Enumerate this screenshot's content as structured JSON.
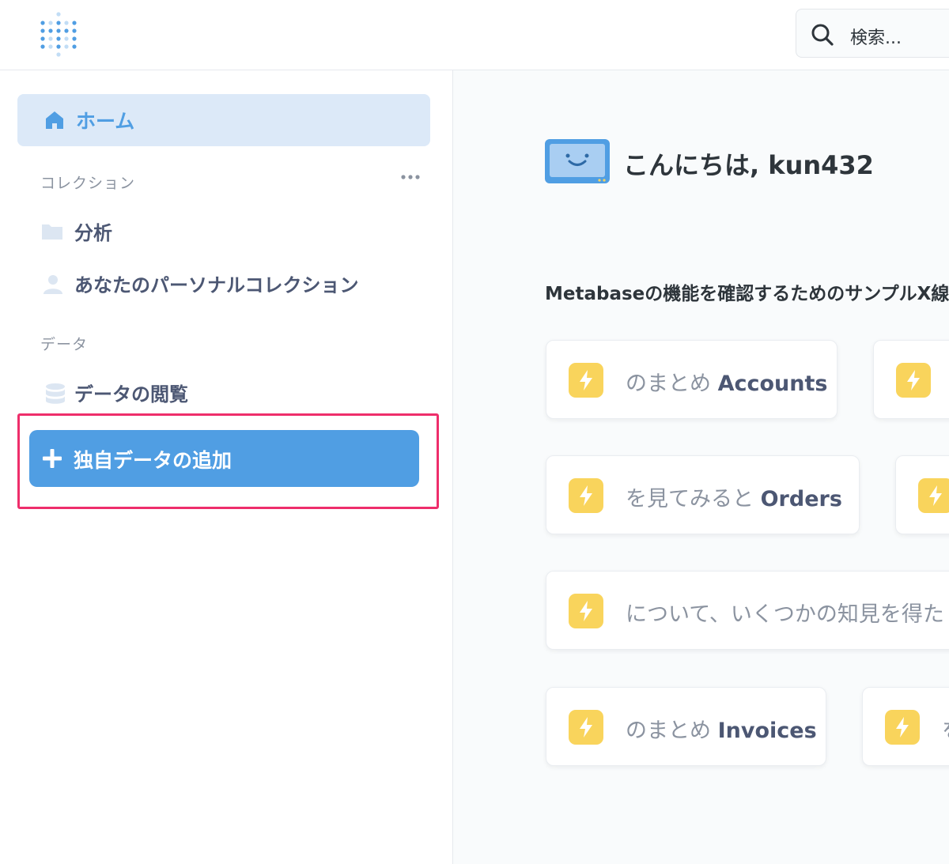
{
  "header": {
    "search_placeholder": "検索..."
  },
  "sidebar": {
    "home_label": "ホーム",
    "collections_title": "コレクション",
    "collections": [
      {
        "label": "分析",
        "icon": "folder-icon"
      },
      {
        "label": "あなたのパーソナルコレクション",
        "icon": "person-icon"
      }
    ],
    "data_title": "データ",
    "browse_data_label": "データの閲覧",
    "add_data_label": "独自データの追加"
  },
  "main": {
    "greeting": "こんにちは, kun432",
    "subheading": "Metabaseの機能を確認するためのサンプルX線",
    "cards": [
      {
        "prefix": "のまとめ",
        "name": "Accounts"
      },
      {
        "prefix": "",
        "name": ""
      },
      {
        "prefix": "を見てみると",
        "name": "Orders"
      },
      {
        "prefix": "",
        "name": ""
      },
      {
        "prefix": "について、いくつかの知見を得た",
        "name": ""
      },
      {
        "prefix": "のまとめ",
        "name": "Invoices"
      },
      {
        "prefix": "を",
        "name": ""
      }
    ]
  },
  "colors": {
    "brand": "#509ee3",
    "highlight": "#ee2e6b",
    "bolt": "#f9d45c",
    "home_bg": "#dce9f8"
  }
}
